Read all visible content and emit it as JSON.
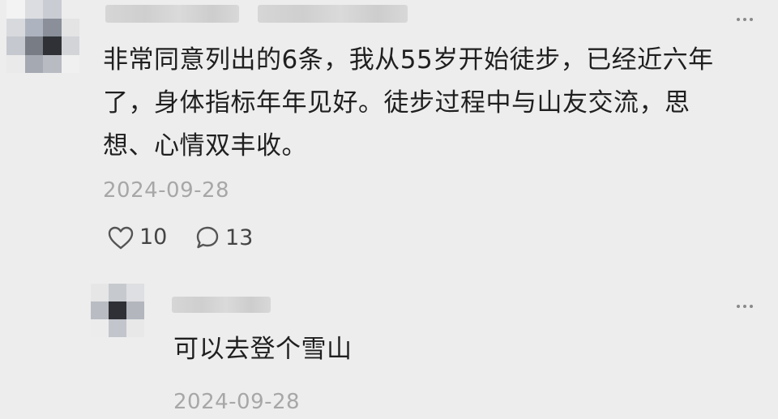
{
  "comment": {
    "text_line1": "非常同意列出的6条，我从55岁开始徒步，已经近六年",
    "text_line2": "了，身体指标年年见好。徒步过程中与山友交流，思",
    "text_line3": "想、心情双丰收。",
    "date": "2024-09-28",
    "likes": "10",
    "replies": "13"
  },
  "reply": {
    "text": "可以去登个雪山",
    "date": "2024-09-28"
  },
  "icons": {
    "like": "heart-outline-icon",
    "comment": "speech-bubble-icon",
    "more": "more-dots-icon"
  }
}
